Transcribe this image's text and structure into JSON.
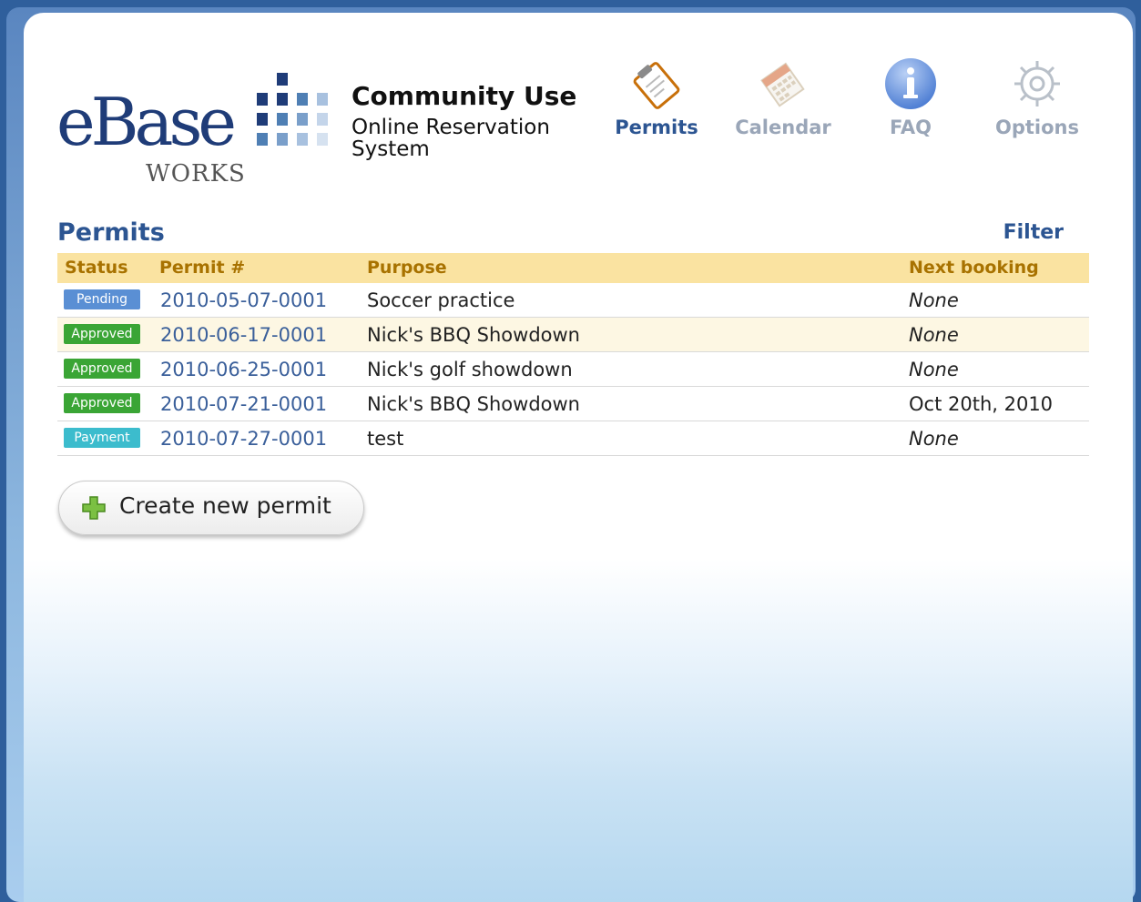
{
  "brand": {
    "logo_text": "eBase",
    "logo_sub": "WORKS",
    "app_title": "Community Use",
    "app_subtitle": "Online Reservation System"
  },
  "nav": [
    {
      "label": "Permits",
      "icon": "clipboard-icon",
      "color": "#2c5592",
      "active": true
    },
    {
      "label": "Calendar",
      "icon": "calendar-icon",
      "color": "#9aa6b8",
      "active": false
    },
    {
      "label": "FAQ",
      "icon": "info-icon",
      "color": "#9aa6b8",
      "active": false
    },
    {
      "label": "Options",
      "icon": "gear-icon",
      "color": "#9aa6b8",
      "active": false
    }
  ],
  "section": {
    "title": "Permits",
    "filter_label": "Filter"
  },
  "table": {
    "headers": [
      "Status",
      "Permit #",
      "Purpose",
      "Next booking"
    ],
    "rows": [
      {
        "status": "Pending",
        "status_color": "#5a8fd4",
        "permit": "2010-05-07-0001",
        "purpose": "Soccer practice",
        "next_booking": "None",
        "italic": true
      },
      {
        "status": "Approved",
        "status_color": "#3aa535",
        "permit": "2010-06-17-0001",
        "purpose": "Nick's BBQ Showdown",
        "next_booking": "None",
        "italic": true
      },
      {
        "status": "Approved",
        "status_color": "#3aa535",
        "permit": "2010-06-25-0001",
        "purpose": "Nick's golf showdown",
        "next_booking": "None",
        "italic": true
      },
      {
        "status": "Approved",
        "status_color": "#3aa535",
        "permit": "2010-07-21-0001",
        "purpose": "Nick's BBQ Showdown",
        "next_booking": "Oct 20th, 2010",
        "italic": false
      },
      {
        "status": "Payment",
        "status_color": "#3cbccd",
        "permit": "2010-07-27-0001",
        "purpose": "test",
        "next_booking": "None",
        "italic": true
      }
    ]
  },
  "create_button": {
    "label": "Create new permit",
    "icon": "plus-icon"
  }
}
